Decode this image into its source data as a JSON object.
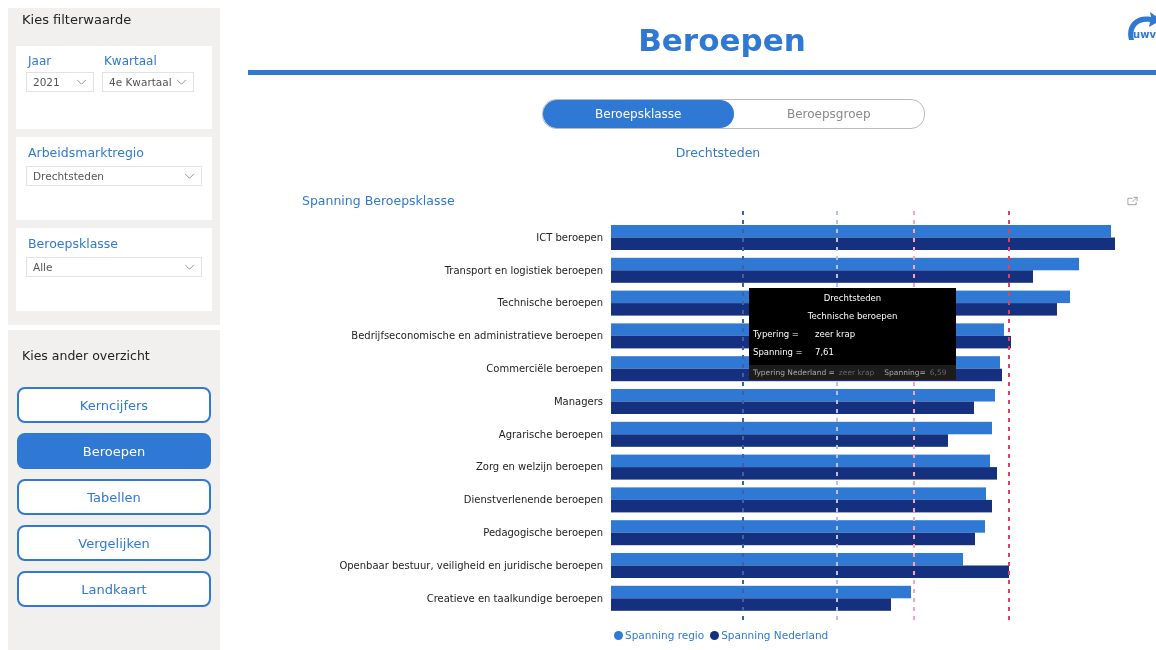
{
  "filter_panel": {
    "title": "Kies filterwaarde",
    "filters": [
      {
        "label": "Jaar",
        "value": "2021"
      },
      {
        "label": "Kwartaal",
        "value": "4e Kwartaal"
      },
      {
        "label": "Arbeidsmarktregio",
        "value": "Drechtsteden"
      },
      {
        "label": "Beroepsklasse",
        "value": "Alle"
      }
    ]
  },
  "nav_panel": {
    "title": "Kies ander overzicht",
    "buttons": [
      {
        "label": "Kerncijfers",
        "selected": false
      },
      {
        "label": "Beroepen",
        "selected": true
      },
      {
        "label": "Tabellen",
        "selected": false
      },
      {
        "label": "Vergelijken",
        "selected": false
      },
      {
        "label": "Landkaart",
        "selected": false
      }
    ]
  },
  "header": {
    "title": "Beroepen",
    "logo_text": "uwv"
  },
  "toggle": [
    {
      "label": "Beroepsklasse",
      "selected": true
    },
    {
      "label": "Beroepsgroep",
      "selected": false
    }
  ],
  "region": "Drechtsteden",
  "chart": {
    "title": "Spanning Beroepsklasse",
    "categories": [
      "ICT beroepen",
      "Transport en logistiek beroepen",
      "Technische beroepen",
      "Bedrijfseconomische en administratieve beroepen",
      "Commerciële beroepen",
      "Managers",
      "Agrarische beroepen",
      "Zorg en welzijn beroepen",
      "Dienstverlenende beroepen",
      "Pedagogische beroepen",
      "Openbaar bestuur, veiligheid en juridische beroepen",
      "Creatieve en taalkundige beroepen"
    ],
    "legend": [
      {
        "name": "Spanning regio",
        "color": "#2f78d3"
      },
      {
        "name": "Spanning Nederland",
        "color": "#14307f"
      }
    ]
  },
  "tooltip": {
    "title": "Drechtsteden",
    "subtitle": "Technische beroepen",
    "rows": [
      {
        "label": "Typering =",
        "value": "zeer krap"
      },
      {
        "label": "Spanning =",
        "value": "7,61"
      }
    ],
    "footer": [
      {
        "label": "Typering Nederland =",
        "value": "zeer krap"
      },
      {
        "label": "Spanning=",
        "value": "6,59"
      }
    ]
  }
}
